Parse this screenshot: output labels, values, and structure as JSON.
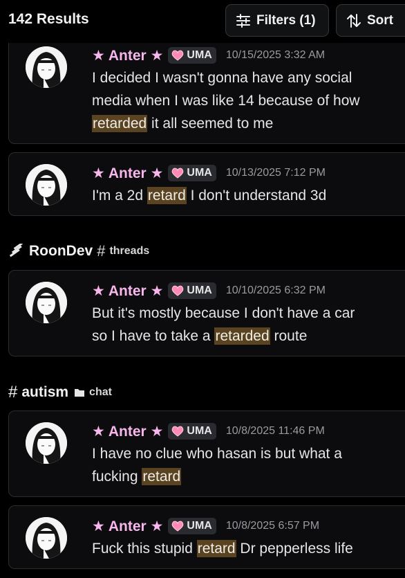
{
  "header": {
    "results_label": "142 Results",
    "filters_label": "Filters (1)",
    "sort_label": "Sort"
  },
  "groups": [
    {
      "section": null,
      "messages": [
        {
          "author": "Anter",
          "tag": "UMA",
          "timestamp": "10/15/2025 3:32 AM",
          "line1": "I decided I wasn't gonna have any social",
          "line2": "media when I was like 14 because of how",
          "pre": "",
          "highlight": "retarded",
          "post": " it all seemed to me"
        },
        {
          "author": "Anter",
          "tag": "UMA",
          "timestamp": "10/13/2025 7:12 PM",
          "pre": "I'm a 2d ",
          "highlight": "retard",
          "post": " I don't understand 3d"
        }
      ]
    },
    {
      "section": {
        "server": "RoonDev",
        "channel": "threads"
      },
      "messages": [
        {
          "author": "Anter",
          "tag": "UMA",
          "timestamp": "10/10/2025 6:32 PM",
          "line1": "But it's mostly because I don't have a car",
          "pre": "so I have to take a ",
          "highlight": "retarded",
          "post": " route"
        }
      ]
    },
    {
      "section": {
        "channel": "autism",
        "category": "chat"
      },
      "messages": [
        {
          "author": "Anter",
          "tag": "UMA",
          "timestamp": "10/8/2025 11:46 PM",
          "line1": "I have no clue who hasan is but what a",
          "pre": "fucking ",
          "highlight": "retard",
          "post": ""
        },
        {
          "author": "Anter",
          "tag": "UMA",
          "timestamp": "10/8/2025 6:57 PM",
          "pre": "Fuck this stupid ",
          "highlight": "retard",
          "post": " Dr pepperless life"
        }
      ]
    }
  ],
  "colors": {
    "author": "#f7b6ec",
    "highlight": "#5a4321",
    "card_bg": "#0c0c0e",
    "card_border": "#2b2c30"
  },
  "icons": {
    "filters": "sliders-icon",
    "sort": "sort-arrows-icon",
    "server": "roondev-server-icon",
    "channel": "hash-icon",
    "category": "folder-icon",
    "tag": "heart-icon"
  }
}
